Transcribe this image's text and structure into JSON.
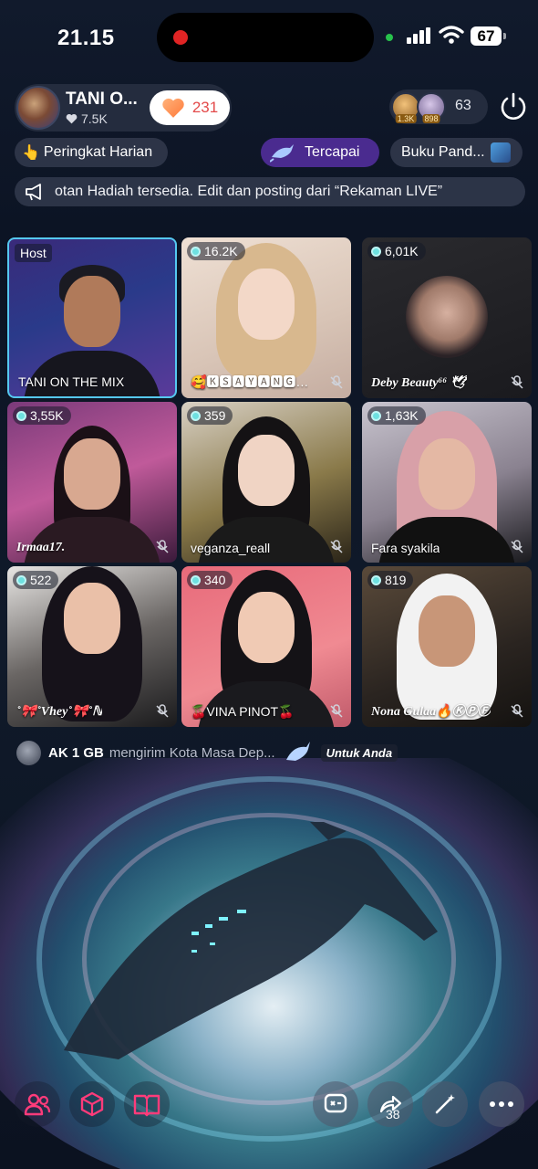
{
  "status_bar": {
    "time": "21.15",
    "battery": "67"
  },
  "host": {
    "name": "TANI O...",
    "likes": "7.5K",
    "follow_count": "231"
  },
  "viewers": {
    "badge_1": "1.3K",
    "badge_2": "898",
    "count": "63"
  },
  "chips": {
    "ranking": "Peringkat Harian",
    "achieved": "Tercapai",
    "guide": "Buku Pand..."
  },
  "announcement": "otan Hadiah tersedia. Edit dan posting dari “Rekaman LIVE”",
  "grid": [
    {
      "label": "Host",
      "name": "TANI ON THE MIX",
      "is_host": true
    },
    {
      "count": "16.2K",
      "name": "🥰🅺🆂🅰🆈🅰🅽🅶…"
    },
    {
      "count": "6,01K",
      "name": "Deby Beauty⁶⁶ 🕊"
    },
    {
      "count": "3,55K",
      "name": "Irmaa17."
    },
    {
      "count": "359",
      "name": "veganza_reall"
    },
    {
      "count": "1,63K",
      "name": "Fara syakila"
    },
    {
      "count": "522",
      "name": "˚🎀˚Vhey˚🎀˚ℕ"
    },
    {
      "count": "340",
      "name": "🍒VINA PINOT🍒"
    },
    {
      "count": "819",
      "name": "Nona Gulaa🔥ⓀⓅⒻ"
    }
  ],
  "gift": {
    "sender": "AK 1 GB",
    "message": "mengirim Kota Masa Dep...",
    "tag": "Untuk Anda"
  },
  "toolbar": {
    "share_count": "38"
  },
  "colors": {
    "accent": "#55c8f0",
    "achieved_bg": "#4a2b8f",
    "follow_count": "#e34a4a",
    "toolbar_pink": "#ff3b7a"
  }
}
